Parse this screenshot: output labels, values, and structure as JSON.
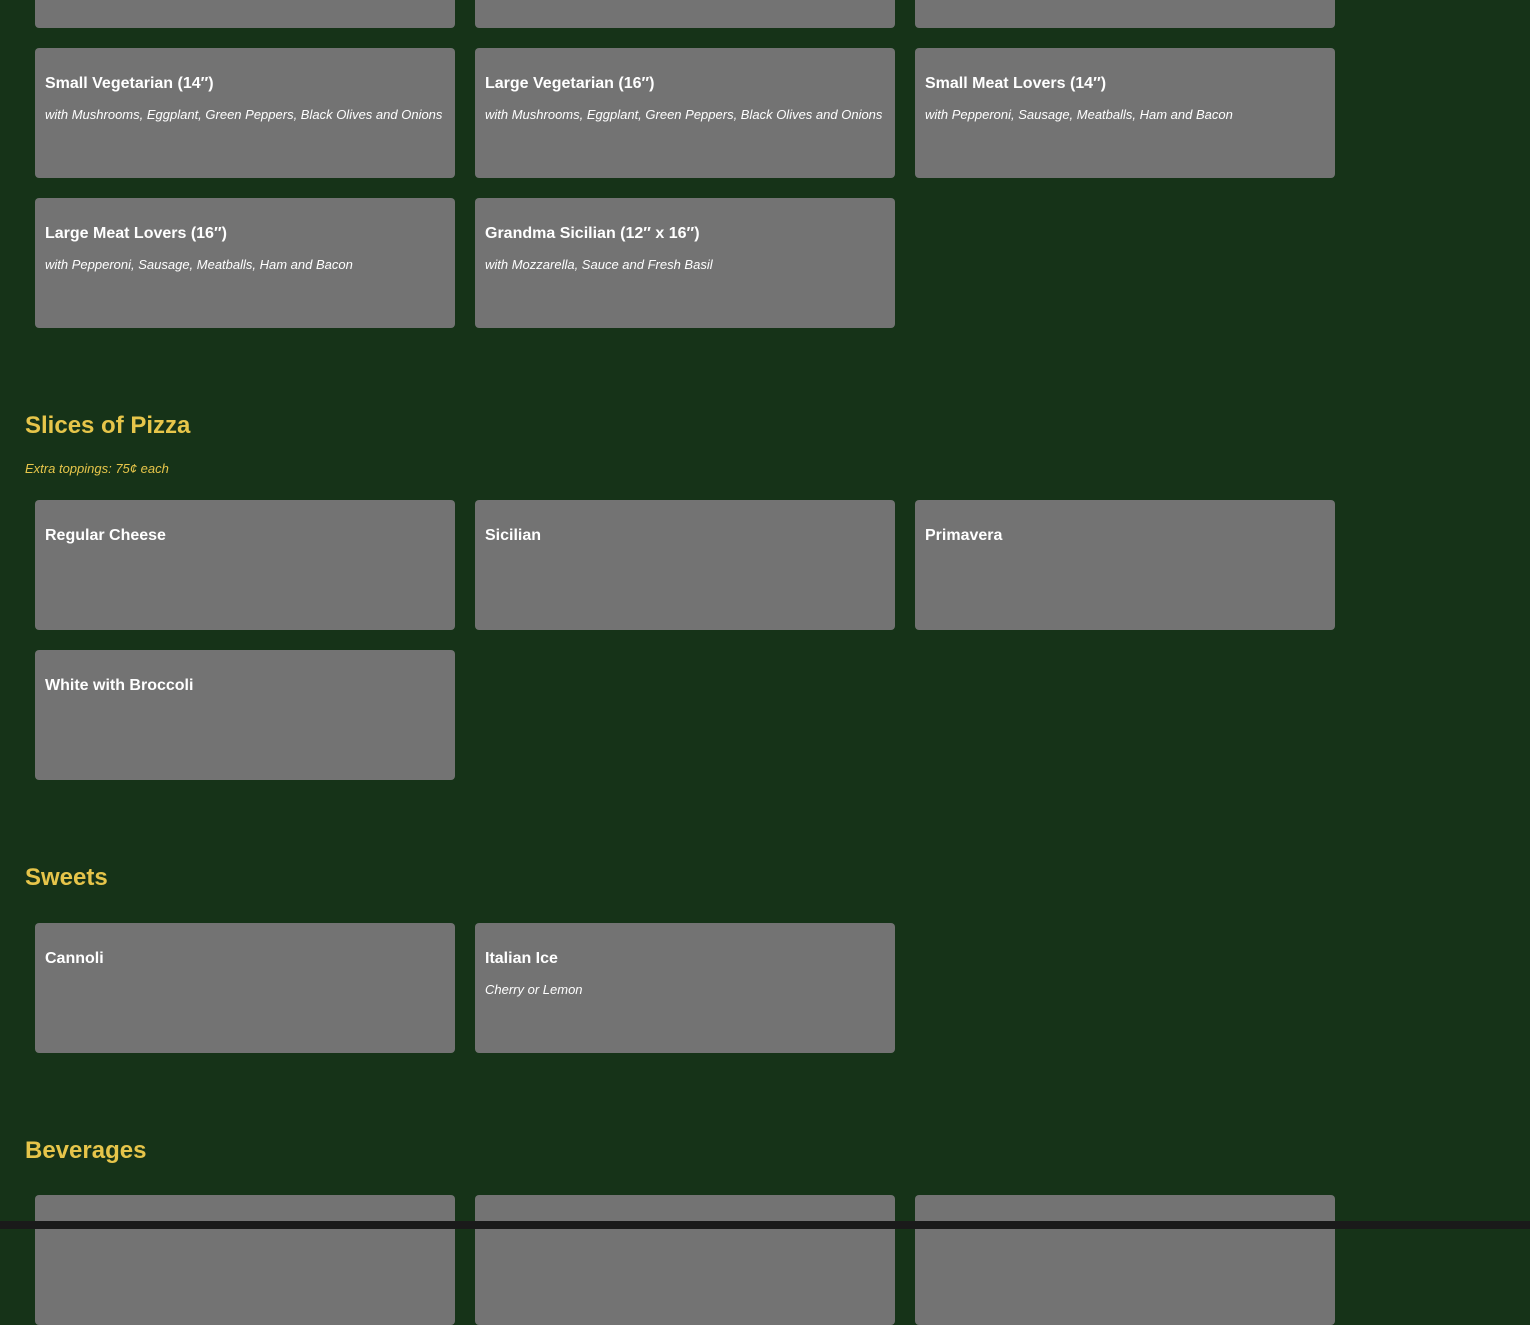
{
  "pizzas": {
    "items": [
      {
        "title": "Small Vegetarian (14″)",
        "desc": "with Mushrooms, Eggplant, Green Peppers, Black Olives and Onions"
      },
      {
        "title": "Large Vegetarian (16″)",
        "desc": "with Mushrooms, Eggplant, Green Peppers, Black Olives and Onions"
      },
      {
        "title": "Small Meat Lovers (14″)",
        "desc": "with Pepperoni, Sausage, Meatballs, Ham and Bacon"
      },
      {
        "title": "Large Meat Lovers (16″)",
        "desc": "with Pepperoni, Sausage, Meatballs, Ham and Bacon"
      },
      {
        "title": "Grandma Sicilian (12″ x 16″)",
        "desc": "with Mozzarella, Sauce and Fresh Basil"
      }
    ]
  },
  "slices": {
    "title": "Slices of Pizza",
    "note": "Extra toppings: 75¢ each",
    "items": [
      {
        "title": "Regular Cheese"
      },
      {
        "title": "Sicilian"
      },
      {
        "title": "Primavera"
      },
      {
        "title": "White with Broccoli"
      }
    ]
  },
  "sweets": {
    "title": "Sweets",
    "items": [
      {
        "title": "Cannoli"
      },
      {
        "title": "Italian Ice",
        "desc": "Cherry or Lemon"
      }
    ]
  },
  "beverages": {
    "title": "Beverages"
  },
  "colors": {
    "background": "#163318",
    "card": "#737373",
    "heading": "#e6c54a"
  }
}
